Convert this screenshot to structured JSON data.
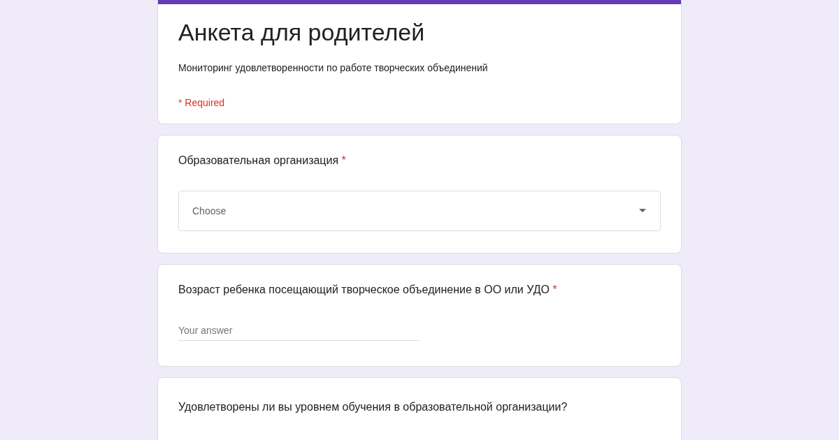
{
  "form": {
    "title": "Анкета для родителей",
    "description": "Мониторинг удовлетворенности по работе творческих объединений",
    "required_note": "* Required"
  },
  "questions": [
    {
      "kind": "dropdown",
      "label": "Образовательная организация",
      "required_mark": "*",
      "placeholder": "Choose"
    },
    {
      "kind": "text",
      "label": "Возраст ребенка посещающий творческое объединение в ОО или УДО",
      "required_mark": "*",
      "placeholder": "Your answer"
    },
    {
      "kind": "open",
      "label": "Удовлетворены ли вы уровнем обучения в образовательной организации?"
    }
  ]
}
